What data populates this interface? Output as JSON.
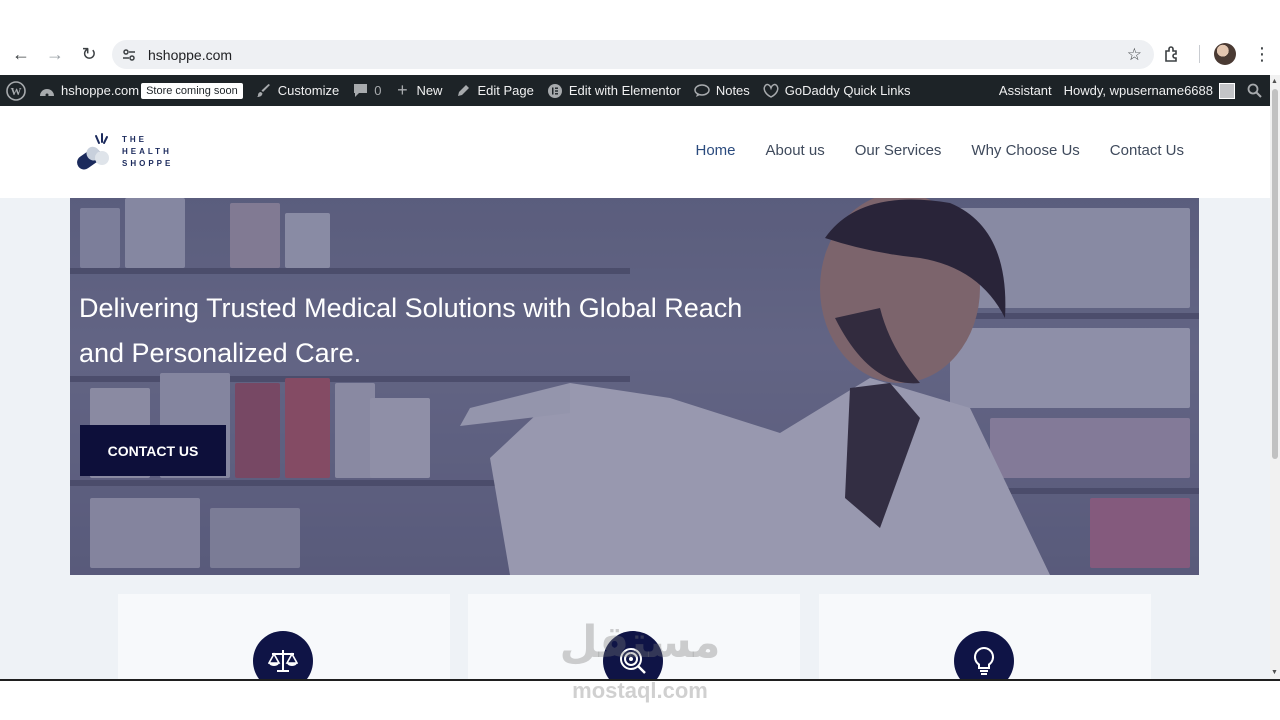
{
  "browser": {
    "url": "hshoppe.com"
  },
  "adminbar": {
    "site_name": "hshoppe.com",
    "store_badge": "Store coming soon",
    "customize": "Customize",
    "comments_count": "0",
    "new": "New",
    "edit_page": "Edit Page",
    "edit_elementor": "Edit with Elementor",
    "notes": "Notes",
    "godaddy": "GoDaddy Quick Links",
    "assistant": "Assistant",
    "howdy": "Howdy, wpusername6688"
  },
  "site": {
    "logo_lines": [
      "THE",
      "HEALTH",
      "SHOPPE"
    ],
    "nav": [
      "Home",
      "About us",
      "Our Services",
      "Why Choose Us",
      "Contact Us"
    ]
  },
  "hero": {
    "title": "Delivering Trusted Medical Solutions with Global Reach and Personalized Care.",
    "cta": "CONTACT US"
  },
  "features": [
    {
      "icon": "balance-scale-icon"
    },
    {
      "icon": "target-search-icon"
    },
    {
      "icon": "lightbulb-icon"
    }
  ],
  "watermark": {
    "arabic": "مستقل",
    "latin": "mostaql.com"
  },
  "colors": {
    "adminbar_bg": "#1d2327",
    "hero_button": "#0d0f3a",
    "icon_circle": "#0f1446",
    "nav_active": "#2b4b7e"
  }
}
